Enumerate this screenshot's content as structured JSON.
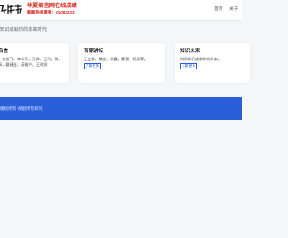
{
  "header": {
    "brand_title": "华夏格言网在线成绩",
    "brand_subtitle": "新闻热线直拨：01083223",
    "nav": [
      {
        "label": "首页"
      },
      {
        "label": "关于"
      }
    ]
  },
  "intro": {
    "text": "知识成就你的未来时代"
  },
  "cards": [
    {
      "title": "名言",
      "description": "，名言飞，李水乐，孔阵，王明，陈，高，戴建业，高雅冲，王树润"
    },
    {
      "title": "百家讲坛",
      "description": "王立群，樊迪，康震，蒙曼，杨雨等。",
      "button_label": "了解更多"
    },
    {
      "title": "知识未来",
      "description": "科学知识成就你的未来。",
      "button_label": "了解更多"
    }
  ],
  "footer": {
    "text": "版权所有·保留所有权利"
  },
  "colors": {
    "brand_red": "#d6241d",
    "footer_blue": "#2b5fd9"
  }
}
